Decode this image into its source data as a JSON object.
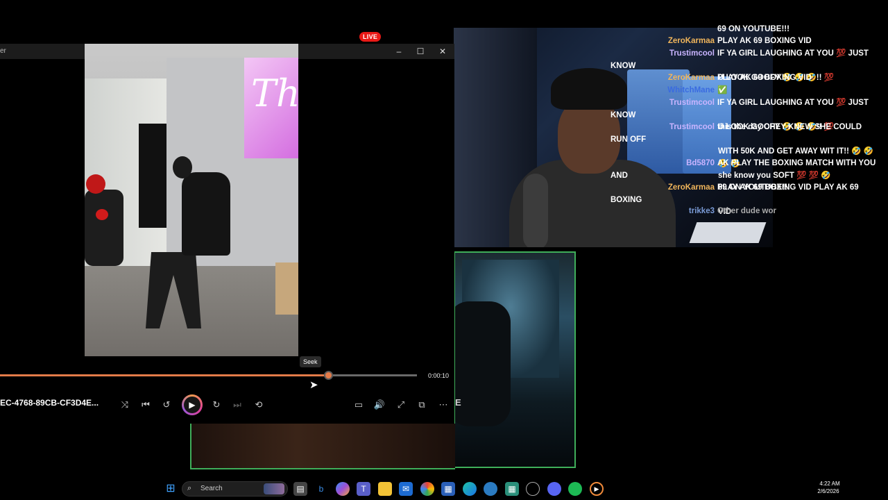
{
  "stream": {
    "live_badge": "LIVE",
    "chat": [
      {
        "user": "",
        "text": "69 ON YOUTUBE!!!",
        "cont": "",
        "color": "#ffffff"
      },
      {
        "user": "ZeroKarmaa",
        "text": "PLAY AK 69 BOXING VID",
        "cont": "",
        "color": "#f0b55b"
      },
      {
        "user": "Trustimcool",
        "text": "IF YA GIRL LAUGHING AT YOU 💯 JUST KNOW",
        "cont": "U LOOK GOOFY 🤣 🤣 🤣!! 💯",
        "color": "#c9b4ff"
      },
      {
        "user": "ZeroKarmaa",
        "text": "PLAY AK 69 BOXING VID",
        "cont": "",
        "color": "#f0b55b"
      },
      {
        "user": "WhitchMane",
        "text": "✅",
        "cont": "",
        "color": "#3a6be0"
      },
      {
        "user": "Trustimcool",
        "text": "IF YA GIRL LAUGHING AT YOU 💯 JUST KNOW",
        "cont": "U LOOK GOOFY 🤣 🤣 🤣!! 💯",
        "color": "#c9b4ff"
      },
      {
        "user": "Trustimcool",
        "text": "this the day CHEY KNEW SHE COULD RUN OFF",
        "cont": "WITH 50K AND GET AWAY WIT IT!! 🤣 🤣 🤣 🤣",
        "cont2": "she know you SOFT 💯 💯 🤣",
        "color": "#c9b4ff"
      },
      {
        "user": "Bd5870",
        "text": "AK PLAY THE BOXING MATCH WITH YOU AND",
        "cont": "69 ON YOUTUBE!!!",
        "color": "#c9b4ff"
      },
      {
        "user": "ZeroKarmaa",
        "text": "PLAY AK 69 BOXING VID PLAY AK 69 BOXING",
        "cont": "VID",
        "color": "#f0b55b"
      },
      {
        "user": "trikke3",
        "text": "Other dude wor",
        "cont": "",
        "color": "#7a9bd6"
      }
    ],
    "guest_overlay_letter": "E"
  },
  "player": {
    "window_title": "er",
    "minimize": "–",
    "maximize": "☐",
    "close": "✕",
    "seek_tooltip": "Seek",
    "time": "0:00:10",
    "progress_fraction": 0.787,
    "file_name": "EC-4768-89CB-CF3D4E...",
    "neon_text": "Th",
    "controls": {
      "shuffle": "⤨",
      "previous": "⏮",
      "rewind": "↺",
      "play": "▶",
      "forward": "↻",
      "next": "⏭",
      "repeat": "⟲",
      "captions": "▭",
      "volume": "🔊",
      "fullscreen": "⤢",
      "miniplayer": "⧉",
      "more": "⋯"
    },
    "accent": "#e37b49"
  },
  "taskbar": {
    "search_placeholder": "Search",
    "time": "4:22 AM",
    "date": "2/6/2026"
  }
}
